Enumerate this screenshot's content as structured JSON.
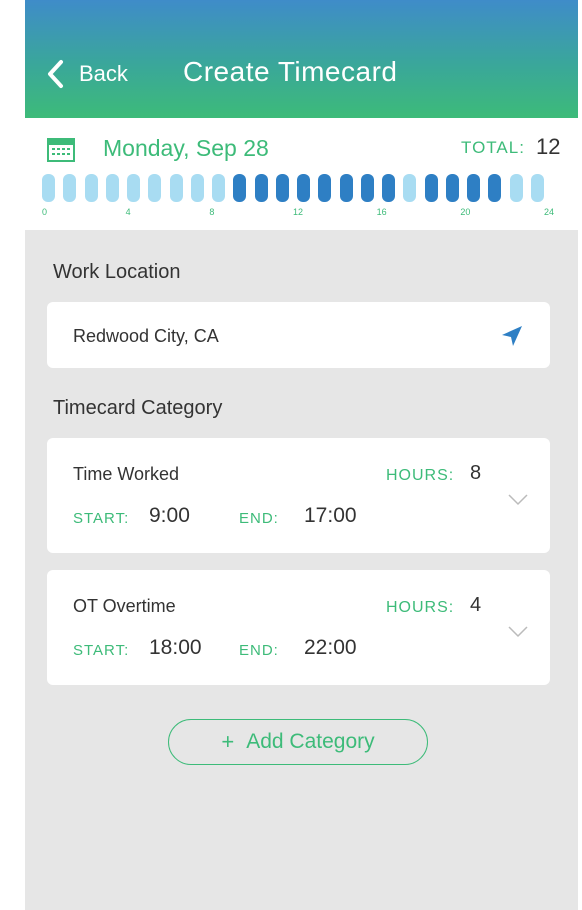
{
  "header": {
    "back_label": "Back",
    "title": "Create Timecard"
  },
  "date_bar": {
    "date": "Monday, Sep 28",
    "total_label": "TOTAL:",
    "total_value": "12",
    "hour_ticks": [
      "0",
      "4",
      "8",
      "12",
      "16",
      "20",
      "24"
    ],
    "segments": 24,
    "worked_ranges": [
      [
        9,
        17
      ],
      [
        18,
        22
      ]
    ],
    "colors": {
      "active": "#2e7fc4",
      "inactive": "#a8dcf2",
      "accent": "#3dbb79"
    }
  },
  "work_location": {
    "label": "Work Location",
    "value": "Redwood City, CA",
    "icon": "location-arrow-icon"
  },
  "timecard_category": {
    "label": "Timecard Category",
    "items": [
      {
        "name": "Time Worked",
        "hours_label": "HOURS:",
        "hours": "8",
        "start_label": "START:",
        "start": "9:00",
        "end_label": "END:",
        "end": "17:00"
      },
      {
        "name": "OT Overtime",
        "hours_label": "HOURS:",
        "hours": "4",
        "start_label": "START:",
        "start": "18:00",
        "end_label": "END:",
        "end": "22:00"
      }
    ]
  },
  "add_category": {
    "label": "Add Category",
    "icon": "plus-icon"
  }
}
